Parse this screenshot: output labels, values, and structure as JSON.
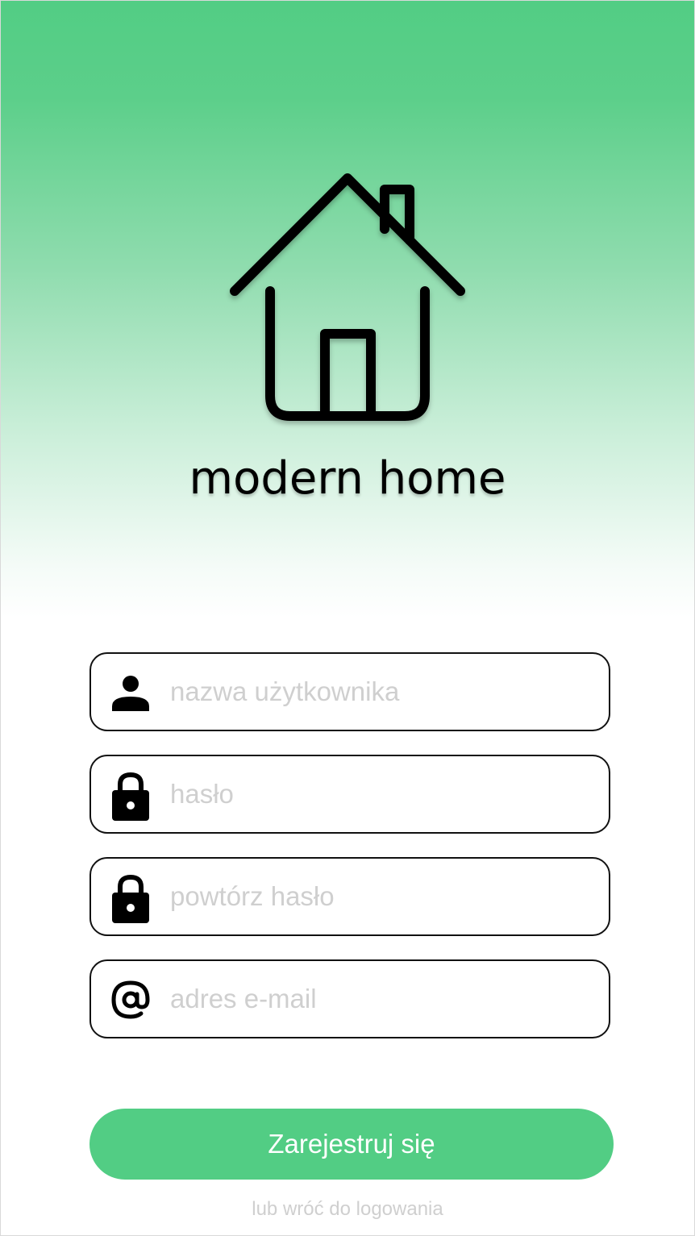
{
  "brand": {
    "logo_icon": "house-icon",
    "title": "modern home"
  },
  "form": {
    "fields": [
      {
        "icon": "user-icon",
        "placeholder": "nazwa użytkownika",
        "value": ""
      },
      {
        "icon": "lock-icon",
        "placeholder": "hasło",
        "value": ""
      },
      {
        "icon": "lock-icon",
        "placeholder": "powtórz hasło",
        "value": ""
      },
      {
        "icon": "at-icon",
        "placeholder": "adres e-mail",
        "value": ""
      }
    ],
    "submit_label": "Zarejestruj się",
    "back_to_login_label": "lub wróć do logowania"
  },
  "colors": {
    "accent": "#52cd84",
    "placeholder": "#cfcfcf",
    "border": "#111111"
  }
}
